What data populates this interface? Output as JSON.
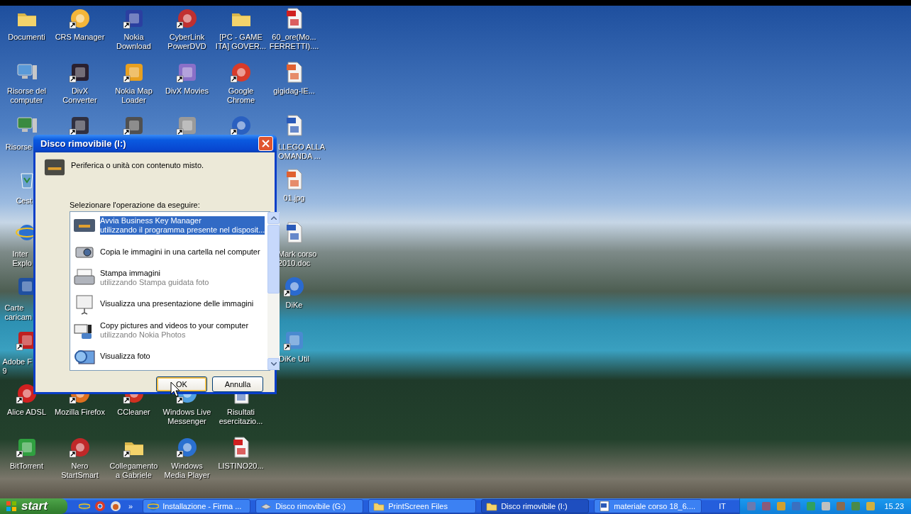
{
  "desktop_icons": [
    {
      "label": "Documenti",
      "shortcut": false
    },
    {
      "label": "CRS Manager",
      "shortcut": true
    },
    {
      "label": "Nokia\nDownload",
      "shortcut": true
    },
    {
      "label": "CyberLink\nPowerDVD",
      "shortcut": true
    },
    {
      "label": "[PC - GAME\nITA] GOVER...",
      "shortcut": false
    },
    {
      "label": "60_ore(Mo...\nFERRETTI)....",
      "shortcut": false
    },
    {
      "label": "Risorse del\ncomputer",
      "shortcut": false
    },
    {
      "label": "DivX\nConverter",
      "shortcut": true
    },
    {
      "label": "Nokia Map\nLoader",
      "shortcut": true
    },
    {
      "label": "DivX Movies",
      "shortcut": true
    },
    {
      "label": "Google\nChrome",
      "shortcut": true
    },
    {
      "label": "gigidag-IE...",
      "shortcut": false
    },
    {
      "label": "Risorse",
      "shortcut": false
    },
    {
      "shortcut": true
    },
    {
      "shortcut": true
    },
    {
      "shortcut": true
    },
    {
      "shortcut": true
    },
    {
      "label": "LLEGO ALLA\nOMANDA ...",
      "shortcut": false
    },
    {
      "label": "Cest",
      "shortcut": false
    },
    {
      "label": "01.jpg",
      "shortcut": false
    },
    {
      "label": "Inter\nExplo",
      "shortcut": false
    },
    {
      "label": "Mark corso\n2010.doc",
      "shortcut": false
    },
    {
      "label": "Carte\ncaricam",
      "shortcut": false
    },
    {
      "label": "DiKe",
      "shortcut": true
    },
    {
      "label": "Adobe F\n9",
      "shortcut": true
    },
    {
      "label": "DiKe Util",
      "shortcut": true
    },
    {
      "label": "Alice ADSL",
      "shortcut": true
    },
    {
      "label": "Mozilla Firefox",
      "shortcut": true
    },
    {
      "label": "CCleaner",
      "shortcut": true
    },
    {
      "label": "Windows Live\nMessenger",
      "shortcut": true
    },
    {
      "label": "Risultati\nesercitazio...",
      "shortcut": false
    },
    {
      "label": "BitTorrent",
      "shortcut": true
    },
    {
      "label": "Nero\nStartSmart",
      "shortcut": true
    },
    {
      "label": "Collegamento\na Gabriele",
      "shortcut": true
    },
    {
      "label": "Windows\nMedia Player",
      "shortcut": true
    },
    {
      "label": "LISTINO20...",
      "shortcut": false
    }
  ],
  "dialog": {
    "title": "Disco rimovibile (I:)",
    "description": "Periferica o unità con contenuto misto.",
    "prompt": "Selezionare l'operazione da eseguire:",
    "actions": [
      {
        "title": "Avvia Business Key Manager",
        "subtitle": "utilizzando il programma presente nel disposit...",
        "selected": true
      },
      {
        "title": "Copia le immagini in una cartella nel computer",
        "selected": false
      },
      {
        "title": "Stampa immagini",
        "subtitle": "utilizzando Stampa guidata foto",
        "selected": false
      },
      {
        "title": "Visualizza una presentazione delle immagini",
        "selected": false
      },
      {
        "title": "Copy pictures and videos to your computer",
        "subtitle": "utilizzando Nokia Photos",
        "selected": false
      },
      {
        "title": "Visualizza foto",
        "selected": false
      }
    ],
    "buttons": [
      {
        "label": "OK",
        "default": true
      },
      {
        "label": "Annulla",
        "default": false
      }
    ]
  },
  "taskbar": {
    "start": "start",
    "quick_launch_more": "»",
    "tasks": [
      {
        "label": "Installazione - Firma ...",
        "selected": false
      },
      {
        "label": "Disco rimovibile (G:)",
        "selected": false
      },
      {
        "label": "PrintScreen Files",
        "selected": false
      },
      {
        "label": "Disco rimovibile (I:)",
        "selected": true
      },
      {
        "label": "materiale corso 18_6....",
        "selected": false
      }
    ],
    "language": "IT",
    "clock": "15.23"
  }
}
